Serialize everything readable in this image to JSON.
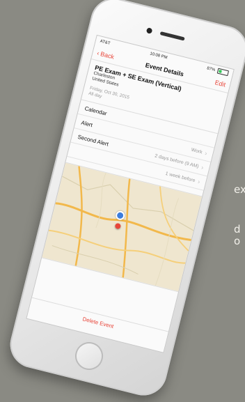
{
  "background": {
    "fragment_1": "ext",
    "fragment_2": "d",
    "fragment_3": "o"
  },
  "status_bar": {
    "carrier": "AT&T",
    "time": "10:08 PM",
    "battery": "87%"
  },
  "nav": {
    "back_label": "Back",
    "title": "Event Details",
    "edit_label": "Edit"
  },
  "event": {
    "title": "PE Exam + SE Exam (Vertical)",
    "location_line1": "Charleston",
    "location_line2": "United States",
    "date": "Friday, Oct 30, 2015",
    "all_day": "All day"
  },
  "rows": {
    "calendar_label": "Calendar",
    "alert_label": "Alert",
    "alert_value": "Work",
    "second_alert_label": "Second Alert",
    "second_alert_value": "2 days before (9 AM)",
    "third_value": "1 week before"
  },
  "delete_label": "Delete Event",
  "colors": {
    "accent": "#e8463a",
    "background": "#8a8a83",
    "map_land": "#efe6cf",
    "map_road": "#f2b84b"
  },
  "icons": [
    "chevron-left-icon",
    "chevron-right-icon",
    "map-pin-icon",
    "location-dot-icon",
    "battery-icon"
  ]
}
